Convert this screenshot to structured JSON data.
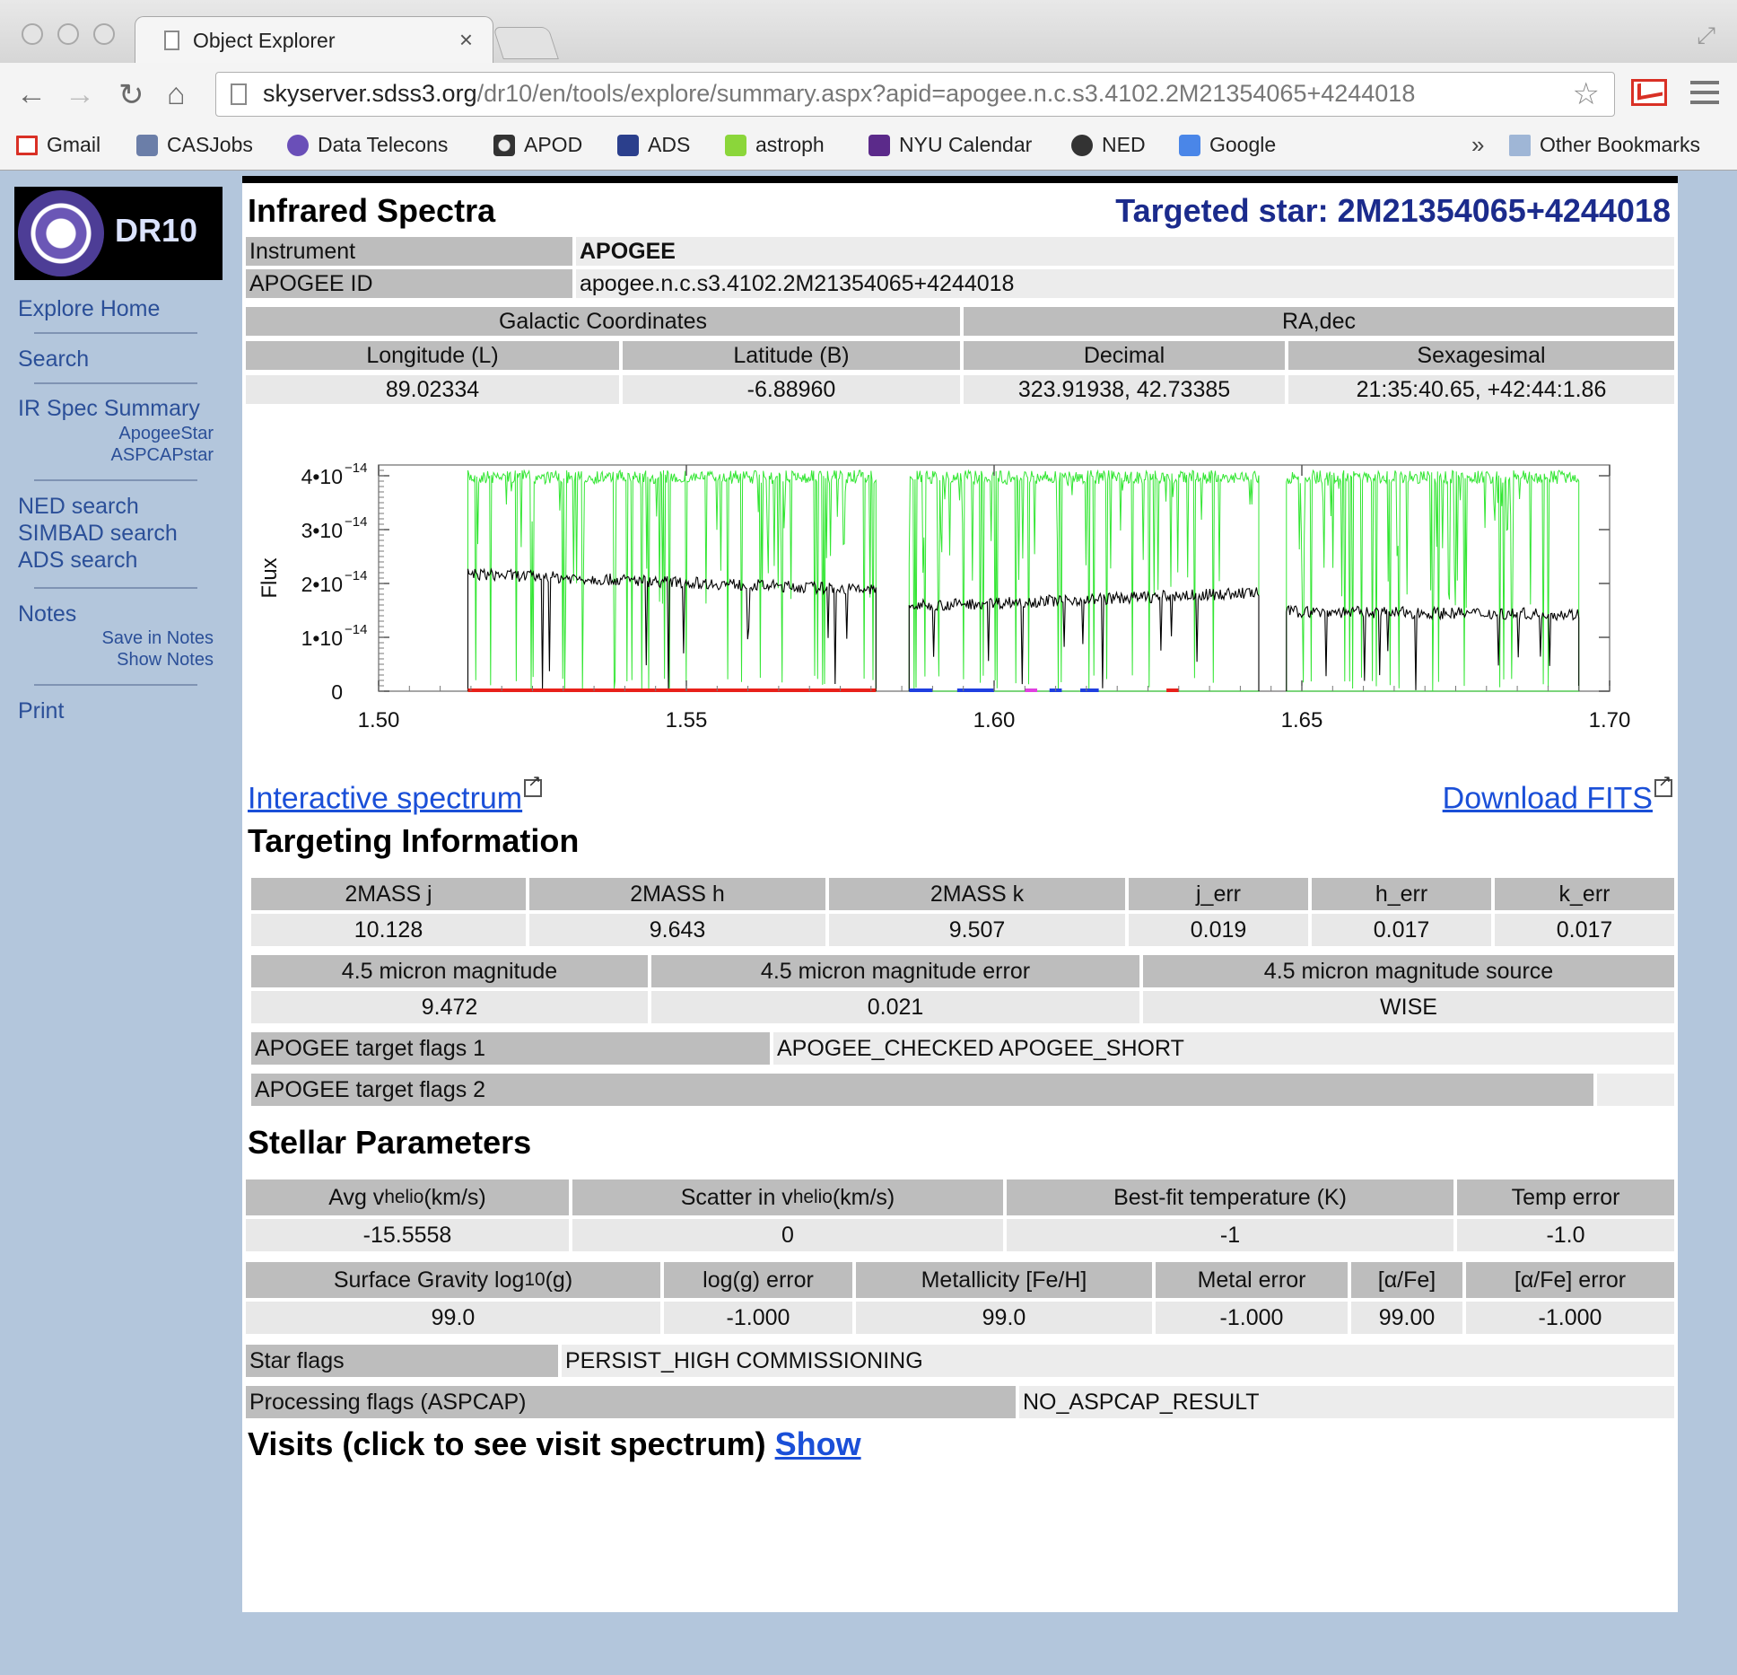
{
  "browser": {
    "tab_title": "Object Explorer",
    "tab_close": "×",
    "url_host": "skyserver.sdss3.org",
    "url_path": "/dr10/en/tools/explore/summary.aspx?apid=apogee.n.c.s3.4102.2M21354065+4244018",
    "bookmarks": [
      {
        "label": "Gmail",
        "color": "#d93025"
      },
      {
        "label": "CASJobs",
        "color": "#6b7ea8"
      },
      {
        "label": "Data Telecons",
        "color": "#6a4fb8"
      },
      {
        "label": "APOD",
        "color": "#333333"
      },
      {
        "label": "ADS",
        "color": "#2b3f8c"
      },
      {
        "label": "astroph",
        "color": "#8bd63a"
      },
      {
        "label": "NYU Calendar",
        "color": "#5b2a8a"
      },
      {
        "label": "NED",
        "color": "#333333"
      },
      {
        "label": "Google",
        "color": "#4a86e8"
      }
    ],
    "bookmarks_more": "»",
    "other_bookmarks": "Other Bookmarks"
  },
  "sidebar": {
    "logo_text": "DR10",
    "explore_home": "Explore Home",
    "search": "Search",
    "ir_spec_summary": "IR Spec Summary",
    "apogee_star": "ApogeeStar",
    "aspcap_star": "ASPCAPstar",
    "ned_search": "NED search",
    "simbad_search": "SIMBAD search",
    "ads_search": "ADS search",
    "notes": "Notes",
    "save_in_notes": "Save in Notes",
    "show_notes": "Show Notes",
    "print": "Print"
  },
  "header": {
    "title": "Infrared Spectra",
    "targeted_star": "Targeted star: 2M21354065+4244018"
  },
  "instrument": {
    "label": "Instrument",
    "value": "APOGEE",
    "id_label": "APOGEE ID",
    "id_value": "apogee.n.c.s3.4102.2M21354065+4244018"
  },
  "coords": {
    "galactic_header": "Galactic Coordinates",
    "radec_header": "RA,dec",
    "longitude_label": "Longitude (L)",
    "latitude_label": "Latitude (B)",
    "decimal_label": "Decimal",
    "sexagesimal_label": "Sexagesimal",
    "longitude": "89.02334",
    "latitude": "-6.88960",
    "decimal": "323.91938, 42.73385",
    "sexagesimal": "21:35:40.65, +42:44:1.86"
  },
  "chart_data": {
    "type": "line",
    "ylabel": "Flux",
    "xlim": [
      1.5,
      1.7
    ],
    "ylim": [
      0,
      4.2e-14
    ],
    "x_ticks": [
      "1.50",
      "1.55",
      "1.60",
      "1.65",
      "1.70"
    ],
    "y_ticks": [
      {
        "mant": "0",
        "exp": ""
      },
      {
        "mant": "1•10",
        "exp": "−14"
      },
      {
        "mant": "2•10",
        "exp": "−14"
      },
      {
        "mant": "3•10",
        "exp": "−14"
      },
      {
        "mant": "4•10",
        "exp": "−14"
      }
    ],
    "grid": false,
    "chips": [
      {
        "x0": 1.5145,
        "x1": 1.5808,
        "continuum": 2.2e-14,
        "end": 1.9e-14
      },
      {
        "x0": 1.5862,
        "x1": 1.643,
        "continuum": 1.6e-14,
        "end": 1.85e-14
      },
      {
        "x0": 1.6475,
        "x1": 1.695,
        "continuum": 1.5e-14,
        "end": 1.45e-14
      }
    ],
    "sky_color": "#33e633",
    "spectrum_color": "#000000",
    "mask_segments": [
      {
        "x0": 1.5145,
        "x1": 1.5808,
        "color": "#e8201a"
      },
      {
        "x0": 1.5862,
        "x1": 1.59,
        "color": "#1f3fe0"
      },
      {
        "x0": 1.594,
        "x1": 1.6,
        "color": "#1f3fe0"
      },
      {
        "x0": 1.605,
        "x1": 1.607,
        "color": "#e040e0"
      },
      {
        "x0": 1.609,
        "x1": 1.611,
        "color": "#1f3fe0"
      },
      {
        "x0": 1.614,
        "x1": 1.617,
        "color": "#1f3fe0"
      },
      {
        "x0": 1.628,
        "x1": 1.63,
        "color": "#e8201a"
      }
    ]
  },
  "links": {
    "interactive": "Interactive spectrum",
    "download": "Download FITS"
  },
  "targeting": {
    "title": "Targeting Information",
    "headers": [
      "2MASS j",
      "2MASS h",
      "2MASS k",
      "j_err",
      "h_err",
      "k_err"
    ],
    "values": [
      "10.128",
      "9.643",
      "9.507",
      "0.019",
      "0.017",
      "0.017"
    ],
    "mag_headers": [
      "4.5 micron magnitude",
      "4.5 micron magnitude error",
      "4.5 micron magnitude source"
    ],
    "mag_values": [
      "9.472",
      "0.021",
      "WISE"
    ],
    "flags1_label": "APOGEE target flags 1",
    "flags1_value": "APOGEE_CHECKED APOGEE_SHORT",
    "flags2_label": "APOGEE target flags 2",
    "flags2_value": ""
  },
  "stellar": {
    "title": "Stellar Parameters",
    "avg_vhelio_pre": "Avg v",
    "avg_vhelio_sub": "helio",
    "avg_vhelio_post": " (km/s)",
    "scatter_pre": "Scatter in v",
    "scatter_sub": "helio",
    "scatter_post": " (km/s)",
    "best_temp": "Best-fit temperature (K)",
    "temp_err": "Temp error",
    "row1_values": [
      "-15.5558",
      "0",
      "-1",
      "-1.0"
    ],
    "logg_pre": "Surface Gravity log",
    "logg_sub": "10",
    "logg_post": "(g)",
    "logg_err": "log(g) error",
    "metallicity": "Metallicity [Fe/H]",
    "metal_err": "Metal error",
    "alpha": "[α/Fe]",
    "alpha_err": "[α/Fe] error",
    "row2_values": [
      "99.0",
      "-1.000",
      "99.0",
      "-1.000",
      "99.00",
      "-1.000"
    ],
    "star_flags_label": "Star flags",
    "star_flags_value": "PERSIST_HIGH COMMISSIONING",
    "proc_flags_label": "Processing flags (ASPCAP)",
    "proc_flags_value": "NO_ASPCAP_RESULT"
  },
  "visits": {
    "title": "Visits (click to see visit spectrum)",
    "show": "Show"
  }
}
